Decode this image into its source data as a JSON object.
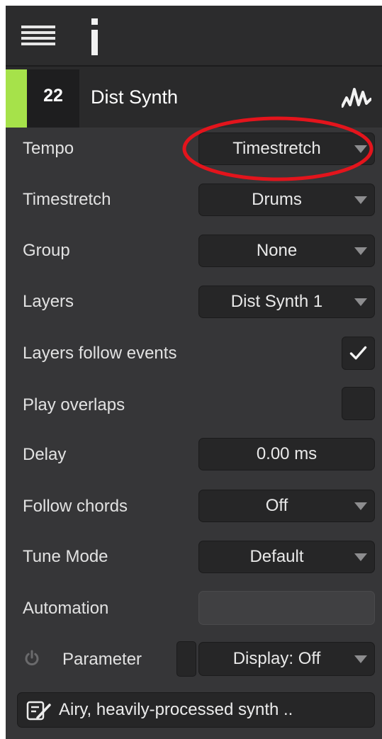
{
  "track": {
    "number": "22",
    "name": "Dist Synth",
    "color": "#a6e24a"
  },
  "icons": {
    "menu": "menu-icon",
    "info": "info-icon",
    "waveform": "waveform-icon",
    "power": "power-icon",
    "notes": "edit-notes-icon",
    "dropdown": "chevron-down-icon",
    "check": "checkmark-icon"
  },
  "rows": {
    "tempo": {
      "label": "Tempo",
      "value": "Timestretch"
    },
    "timestretch": {
      "label": "Timestretch",
      "value": "Drums"
    },
    "group": {
      "label": "Group",
      "value": "None"
    },
    "layers": {
      "label": "Layers",
      "value": "Dist Synth 1"
    },
    "layers_follow": {
      "label": "Layers follow events",
      "checked": true
    },
    "play_overlaps": {
      "label": "Play overlaps",
      "checked": false
    },
    "delay": {
      "label": "Delay",
      "value": "0.00 ms"
    },
    "follow_chords": {
      "label": "Follow chords",
      "value": "Off"
    },
    "tune_mode": {
      "label": "Tune Mode",
      "value": "Default"
    },
    "automation": {
      "label": "Automation",
      "value": ""
    },
    "parameter": {
      "label": "Parameter",
      "value": "Display: Off"
    }
  },
  "notes": {
    "text": "Airy, heavily-processed synth .."
  },
  "colors": {
    "panel_bg": "#363638",
    "field_bg": "#262627",
    "text": "#e2e2e2",
    "highlight": "#e3141c"
  }
}
